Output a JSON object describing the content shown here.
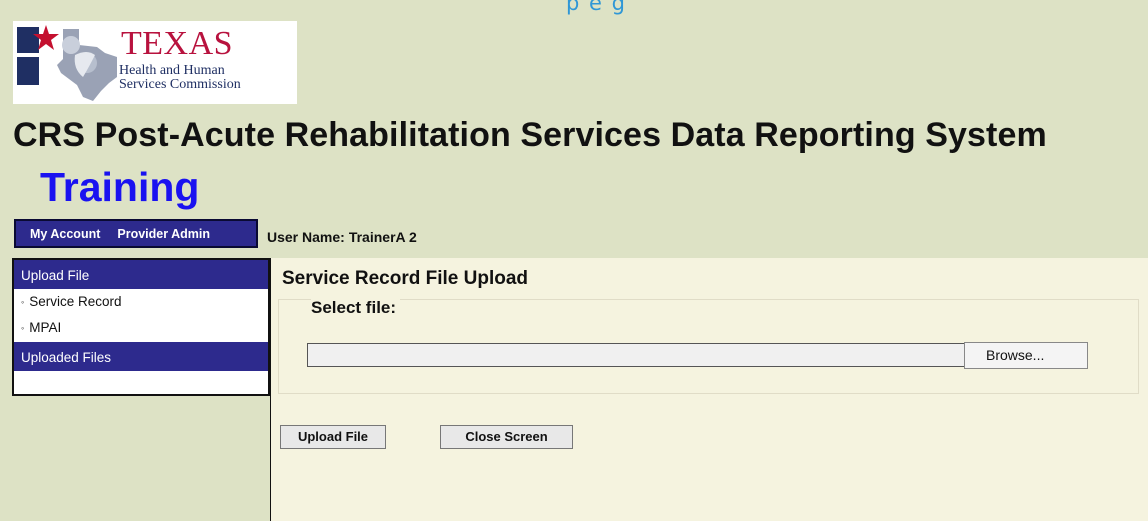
{
  "top_link": "  p  e  g",
  "logo": {
    "name": "TEXAS",
    "line1": "Health and Human",
    "line2": "Services Commission",
    "colors": {
      "red": "#b8123e",
      "navy": "#1f2f63"
    }
  },
  "header": {
    "title": "CRS Post-Acute Rehabilitation Services Data Reporting System",
    "environment": "Training"
  },
  "top_menu": {
    "items": [
      {
        "label": "My Account"
      },
      {
        "label": "Provider Admin"
      }
    ]
  },
  "user": {
    "label": "User Name:",
    "value": "TrainerA 2"
  },
  "sidebar": {
    "sections": [
      {
        "label": "Upload File",
        "items": [
          {
            "label": "Service Record"
          },
          {
            "label": "MPAI"
          }
        ]
      },
      {
        "label": "Uploaded Files",
        "items": []
      }
    ]
  },
  "main": {
    "title": "Service Record File Upload",
    "select_label": "Select file:",
    "file_value": "",
    "browse_label": "Browse...",
    "upload_button": "Upload File",
    "close_button": "Close Screen"
  },
  "colors": {
    "page_bg": "#dde2c5",
    "menu_bg": "#2d2a8d",
    "content_bg": "#f5f3df",
    "environment_text": "#1a12f0"
  }
}
